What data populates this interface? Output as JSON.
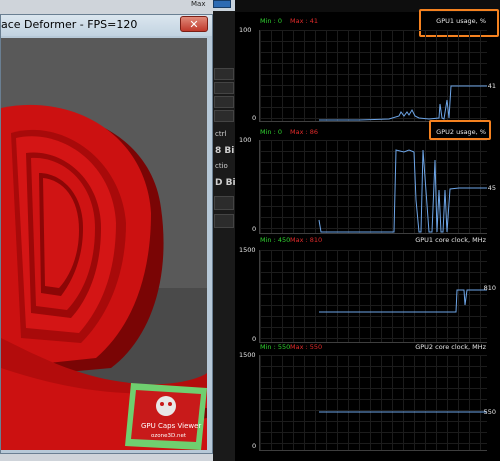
{
  "window": {
    "title": "ace Deformer - FPS=120",
    "close_glyph": "✕",
    "scene_colors": {
      "petal": "#cc1111",
      "petal_dark": "#7a0505",
      "background": "#555555"
    }
  },
  "logo": {
    "lines": [
      "GPU Caps Viewer",
      "ozone3D.net"
    ]
  },
  "side": {
    "max_label": "Max",
    "labels": [
      "ctrl",
      "8 Bi",
      "ctio",
      "D Bi"
    ]
  },
  "graphs": [
    {
      "title": "GPU1 usage, %",
      "min_label": "Min : 0",
      "max_label": "Max : 41",
      "axis_top": "100",
      "axis_bottom": "0",
      "current": "41",
      "highlighted": true,
      "line_color": "#6ea6e8"
    },
    {
      "title": "GPU2 usage, %",
      "min_label": "Min : 0",
      "max_label": "Max : 86",
      "axis_top": "100",
      "axis_bottom": "0",
      "current": "45",
      "highlighted": true,
      "line_color": "#6ea6e8"
    },
    {
      "title": "GPU1 core clock, MHz",
      "min_label": "Min : 450",
      "max_label": "Max : 810",
      "axis_top": "1500",
      "axis_bottom": "0",
      "current": "810",
      "highlighted": false,
      "line_color": "#6ea6e8"
    },
    {
      "title": "GPU2 core clock, MHz",
      "min_label": "Min : 550",
      "max_label": "Max : 550",
      "axis_top": "1500",
      "axis_bottom": "0",
      "current": "550",
      "highlighted": false,
      "line_color": "#6ea6e8"
    }
  ]
}
